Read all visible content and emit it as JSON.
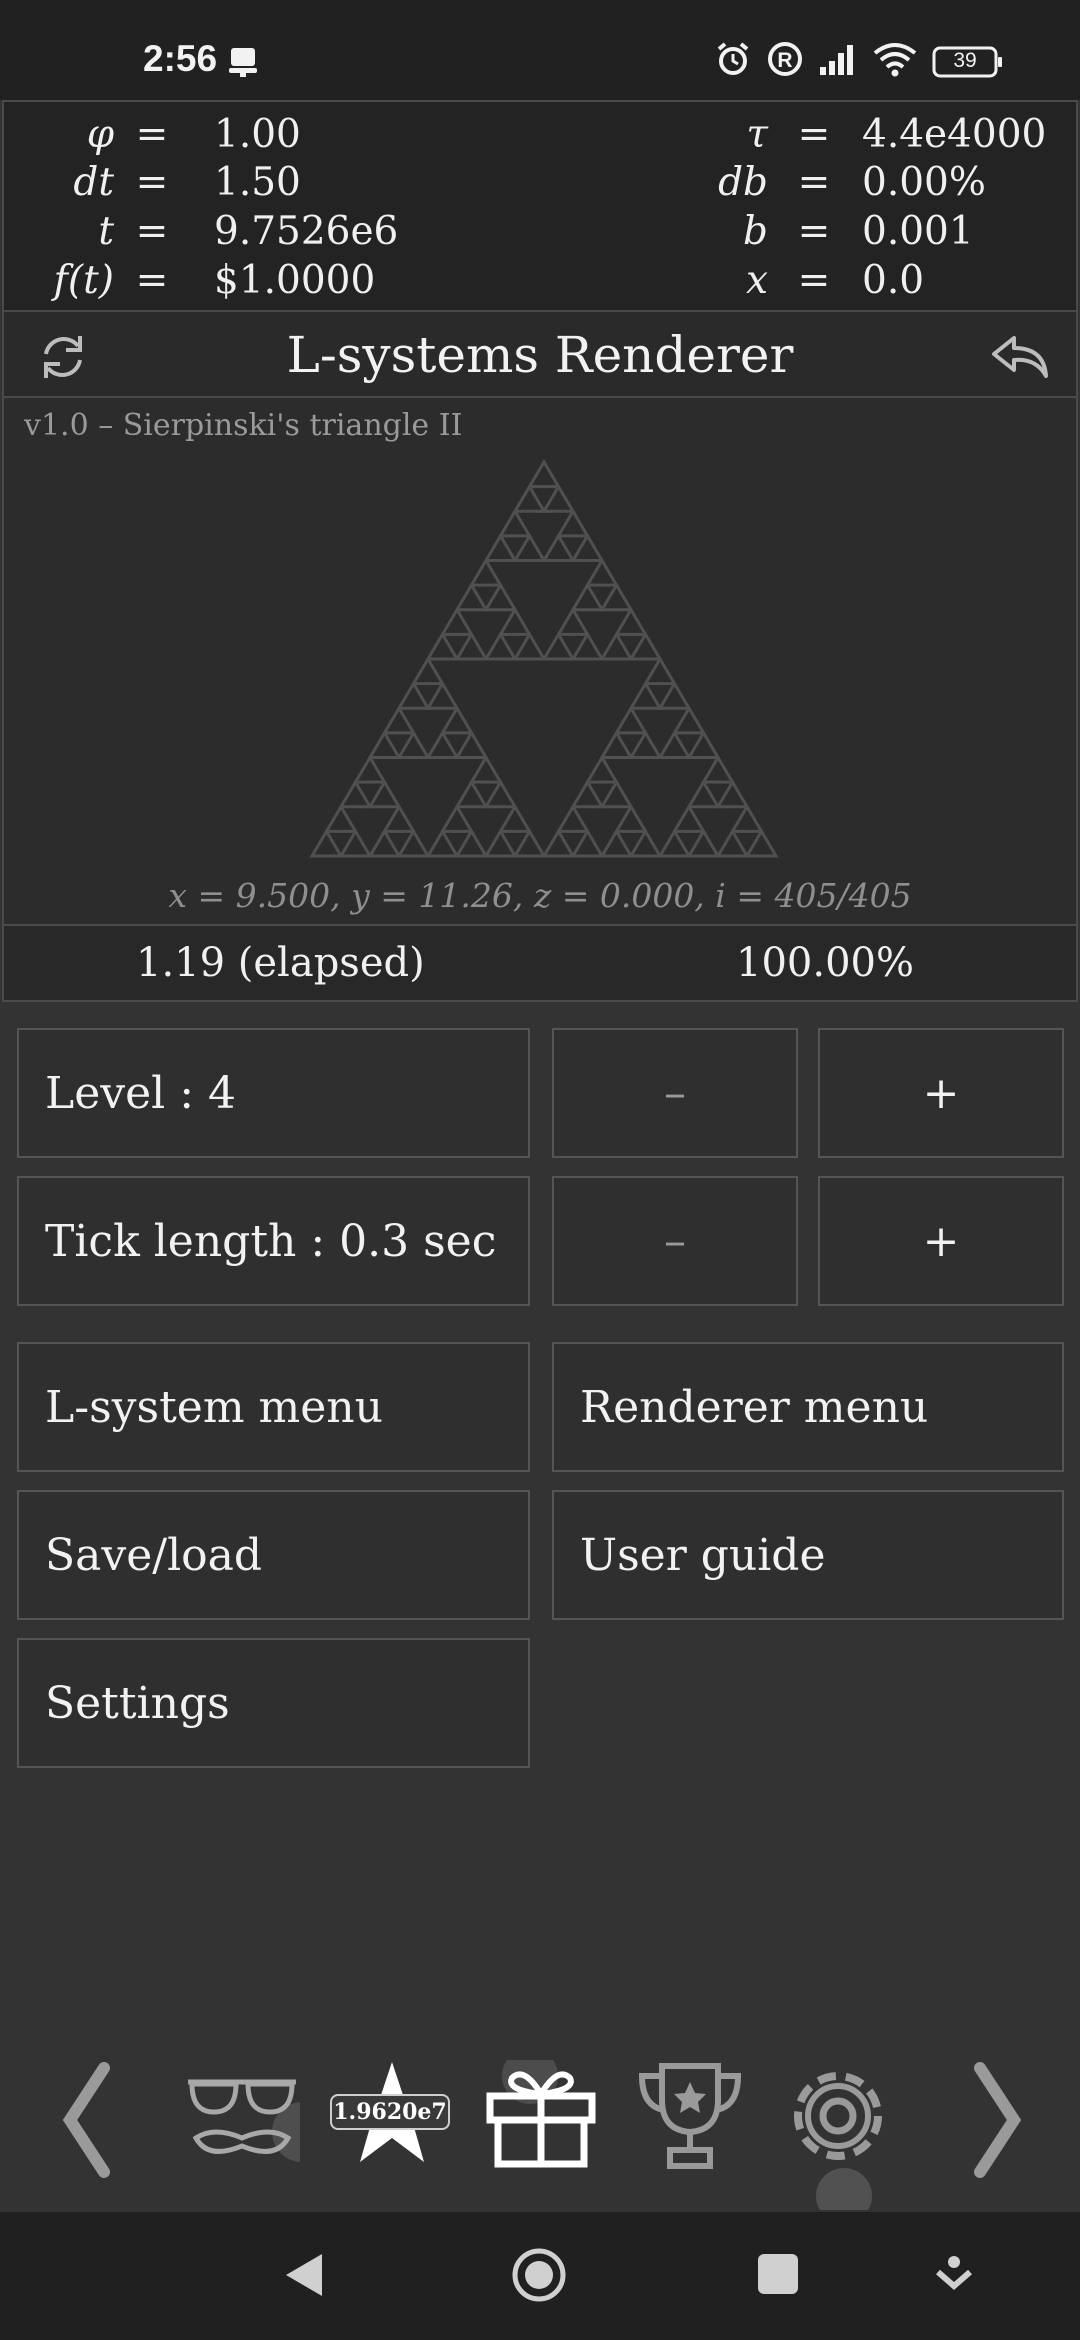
{
  "status_bar": {
    "time": "2:56",
    "battery": "39",
    "icons": [
      "notification-icon",
      "alarm-icon",
      "registered-icon",
      "signal-icon",
      "wifi-icon",
      "battery-icon"
    ]
  },
  "variables": {
    "left": [
      {
        "name": "φ",
        "eq": "=",
        "value": "1.00"
      },
      {
        "name": "dt",
        "eq": "=",
        "value": "1.50"
      },
      {
        "name": "t",
        "eq": "=",
        "value": "9.7526e6"
      },
      {
        "name": "f(t)",
        "eq": "=",
        "value": "$1.0000"
      }
    ],
    "right": [
      {
        "name": "τ",
        "eq": "=",
        "value": "4.4e4000"
      },
      {
        "name": "db",
        "eq": "=",
        "value": "0.00%"
      },
      {
        "name": "b",
        "eq": "=",
        "value": "0.001"
      },
      {
        "name": "x",
        "eq": "=",
        "value": "0.0"
      }
    ]
  },
  "header": {
    "title": "L-systems Renderer"
  },
  "render": {
    "version": "v1.0 – Sierpinski's triangle II",
    "coords": "x = 9.500,   y = 11.26,   z = 0.000,   i = 405/405"
  },
  "progress": {
    "elapsed": "1.19 (elapsed)",
    "percent": "100.00%"
  },
  "controls": {
    "level_label": "Level :  4",
    "tick_label": "Tick length :  0.3 sec",
    "minus": "–",
    "plus": "+",
    "lsystem_menu": "L-system menu",
    "renderer_menu": "Renderer menu",
    "save_load": "Save/load",
    "user_guide": "User guide",
    "settings": "Settings"
  },
  "bottom_nav": {
    "star_value": "1.9620e7",
    "items": [
      "chevron-left-icon",
      "disguise-icon",
      "star-icon",
      "gift-icon",
      "trophy-icon",
      "gear-icon",
      "chevron-right-icon"
    ]
  },
  "colors": {
    "background": "#333333",
    "panel": "#232323",
    "border": "#4a4a4a",
    "text": "#eeeeee",
    "muted": "#8f8f8f",
    "fractal": "#505050"
  }
}
